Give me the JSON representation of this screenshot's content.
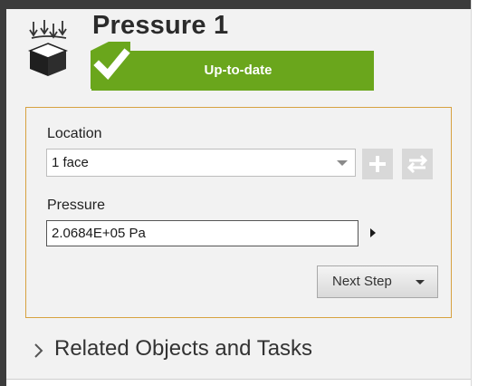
{
  "feature": {
    "title": "Pressure 1",
    "status": "Up-to-date",
    "icon": "pressure-load-icon",
    "status_color": "#6aa61c"
  },
  "location": {
    "label": "Location",
    "value": "1 face",
    "add_icon": "plus-icon",
    "swap_icon": "swap-arrows-icon"
  },
  "pressure": {
    "label": "Pressure",
    "value": "2.0684E+05 Pa"
  },
  "actions": {
    "next_step_label": "Next Step"
  },
  "related": {
    "label": "Related Objects and Tasks"
  },
  "colors": {
    "group_border": "#d7a240",
    "panel_bg": "#f2f2f2"
  }
}
